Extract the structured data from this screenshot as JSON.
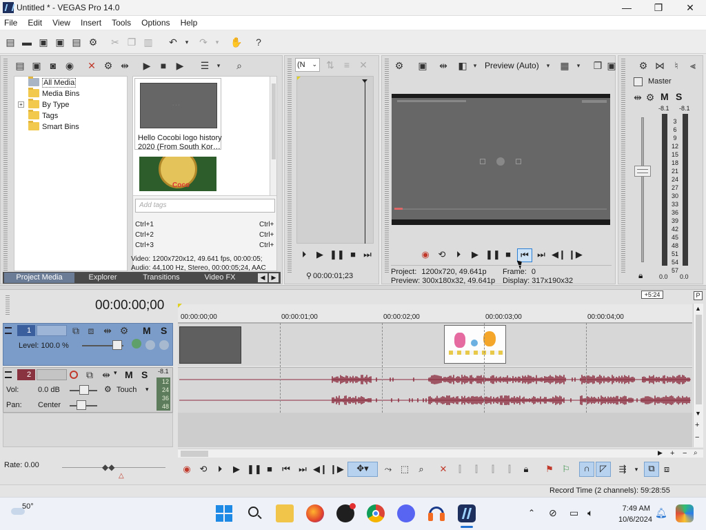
{
  "window": {
    "title": "Untitled * - VEGAS Pro 14.0",
    "minimize": "—",
    "maximize": "❐",
    "close": "✕"
  },
  "menu": [
    "File",
    "Edit",
    "View",
    "Insert",
    "Tools",
    "Options",
    "Help"
  ],
  "project_media": {
    "tree": [
      {
        "label": "All Media",
        "selected": true
      },
      {
        "label": "Media Bins"
      },
      {
        "label": "By Type",
        "expandable": "+"
      },
      {
        "label": "Tags"
      },
      {
        "label": "Smart Bins"
      }
    ],
    "thumbnails": [
      {
        "caption_line1": "Hello Cocobi logo history",
        "caption_line2": "2020 (From South Kor…"
      }
    ],
    "thumb2_logo_text": "Coco",
    "tag_placeholder": "Add tags",
    "shortcuts": [
      {
        "left": "Ctrl+1",
        "right": "Ctrl+"
      },
      {
        "left": "Ctrl+2",
        "right": "Ctrl+"
      },
      {
        "left": "Ctrl+3",
        "right": "Ctrl+"
      }
    ],
    "info_video": "Video: 1200x720x12, 49.641 fps, 00:00:05;",
    "info_audio": "Audio: 44,100 Hz, Stereo, 00:00:05;24, AAC"
  },
  "bottom_tabs": [
    "Project Media",
    "Explorer",
    "Transitions",
    "Video FX"
  ],
  "trimmer": {
    "dropdown": "(N",
    "timecode": "00:00:01;23"
  },
  "preview": {
    "mode": "Preview (Auto)",
    "project_label": "Project:",
    "project_value": "1200x720, 49.641p",
    "preview_label": "Preview:",
    "preview_value": "300x180x32, 49.641p",
    "frame_label": "Frame:",
    "frame_value": "0",
    "display_label": "Display:",
    "display_value": "317x190x32"
  },
  "master": {
    "title": "Master",
    "m_label": "M",
    "s_label": "S",
    "peak_left": "-8.1",
    "peak_right": "-8.1",
    "scale": [
      "3",
      "6",
      "9",
      "12",
      "15",
      "18",
      "21",
      "24",
      "27",
      "30",
      "33",
      "36",
      "39",
      "42",
      "45",
      "48",
      "51",
      "54",
      "57"
    ],
    "fader_left": "0.0",
    "fader_right": "0.0"
  },
  "timeline": {
    "timecode": "00:00:00;00",
    "marker": "+5:24",
    "ruler": [
      "00:00:00;00",
      "00:00:01;00",
      "00:00:02;00",
      "00:00:03;00",
      "00:00:04;00"
    ],
    "video_track": {
      "number": "1",
      "level": "Level: 100.0 %",
      "m": "M",
      "s": "S"
    },
    "audio_track": {
      "number": "2",
      "m": "M",
      "s": "S",
      "vol_label": "Vol:",
      "vol_value": "0.0 dB",
      "pan_label": "Pan:",
      "pan_value": "Center",
      "touch": "Touch",
      "meter_peak": "-8.1",
      "meter_scale": [
        "12",
        "24",
        "36",
        "48"
      ]
    },
    "rate": "Rate: 0.00"
  },
  "status": {
    "record_time": "Record Time (2 channels): 59:28:55"
  },
  "taskbar": {
    "weather": "50°",
    "time": "7:49 AM",
    "date": "10/6/2024"
  },
  "colors": {
    "video_track_head": "#7b9cc8",
    "audio_track_head": "#c9c9c9",
    "waveform": "#8b2a3e",
    "tab_active": "#6b7c96"
  }
}
